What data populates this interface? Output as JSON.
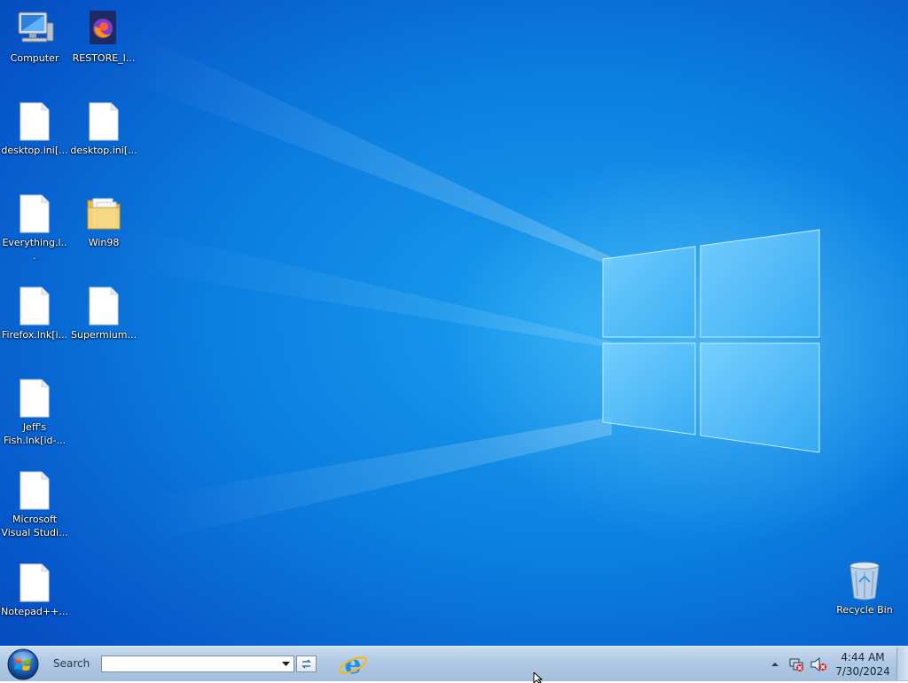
{
  "desktop": {
    "icons": [
      {
        "label": "Computer",
        "icon": "computer-icon"
      },
      {
        "label": "RESTORE_I...",
        "icon": "firefox-icon"
      },
      {
        "label": "desktop.ini[...",
        "icon": "file-icon"
      },
      {
        "label": "desktop.ini[...",
        "icon": "file-icon"
      },
      {
        "label": "Everything.l...",
        "icon": "file-icon"
      },
      {
        "label": "Win98",
        "icon": "folder-icon"
      },
      {
        "label": "Firefox.lnk[i...",
        "icon": "file-icon"
      },
      {
        "label": "Supermium...",
        "icon": "file-icon"
      },
      {
        "label": "Jeff's Fish.lnk[id-...",
        "icon": "file-icon"
      },
      {
        "label": "Microsoft Visual Studi...",
        "icon": "file-icon"
      },
      {
        "label": "Notepad++...",
        "icon": "file-icon"
      },
      {
        "label": "Recycle Bin",
        "icon": "recycle-bin-icon"
      }
    ]
  },
  "taskbar": {
    "search_label": "Search",
    "search_value": "",
    "pinned": [
      {
        "icon": "internet-explorer-icon"
      }
    ],
    "clock_time": "4:44 AM",
    "clock_date": "7/30/2024"
  },
  "colors": {
    "desktop_blue": "#0b7fe0",
    "taskbar": "#afc8e3"
  }
}
